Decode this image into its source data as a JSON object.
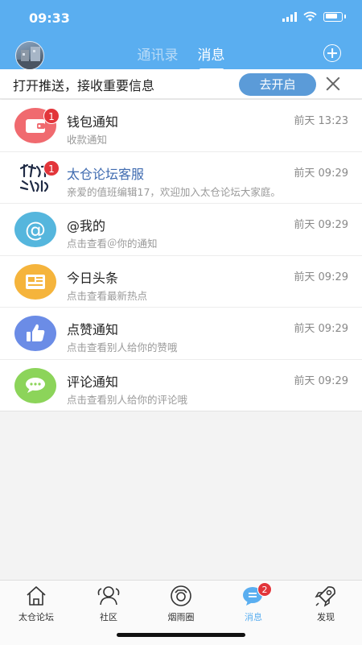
{
  "status": {
    "time": "09:33"
  },
  "header": {
    "tabs": [
      {
        "label": "通讯录",
        "active": false
      },
      {
        "label": "消息",
        "active": true
      }
    ]
  },
  "banner": {
    "text": "打开推送，接收重要信息",
    "button_label": "去开启"
  },
  "messages": [
    {
      "title": "钱包通知",
      "subtitle": "收款通知",
      "time": "前天 13:23",
      "badge": "1",
      "icon": "wallet-icon",
      "color": "#f06a6f"
    },
    {
      "title": "太仓论坛客服",
      "subtitle": "亲爱的值班编辑17，欢迎加入太仓论坛大家庭。",
      "time": "前天 09:29",
      "badge": "1",
      "icon": "calligraphy-avatar"
    },
    {
      "title": "@我的",
      "subtitle": "点击查看＠你的通知",
      "time": "前天 09:29",
      "icon": "at-icon",
      "color": "#55b6dd"
    },
    {
      "title": "今日头条",
      "subtitle": "点击查看最新热点",
      "time": "前天 09:29",
      "icon": "newspaper-icon",
      "color": "#f5b43c"
    },
    {
      "title": "点赞通知",
      "subtitle": "点击查看别人给你的赞哦",
      "time": "前天 09:29",
      "icon": "thumbs-up-icon",
      "color": "#6b8ce6"
    },
    {
      "title": "评论通知",
      "subtitle": "点击查看别人给你的评论哦",
      "time": "前天 09:29",
      "icon": "comment-icon",
      "color": "#8cd45a"
    }
  ],
  "bottom_nav": [
    {
      "label": "太仓论坛",
      "icon": "home-icon"
    },
    {
      "label": "社区",
      "icon": "community-icon"
    },
    {
      "label": "烟雨圈",
      "icon": "camera-circle-icon"
    },
    {
      "label": "消息",
      "icon": "message-icon",
      "badge": "2",
      "active": true
    },
    {
      "label": "发现",
      "icon": "rocket-icon"
    }
  ],
  "colors": {
    "header": "#5aaef0",
    "badge": "#e2353a",
    "button": "#5b9bd8"
  }
}
